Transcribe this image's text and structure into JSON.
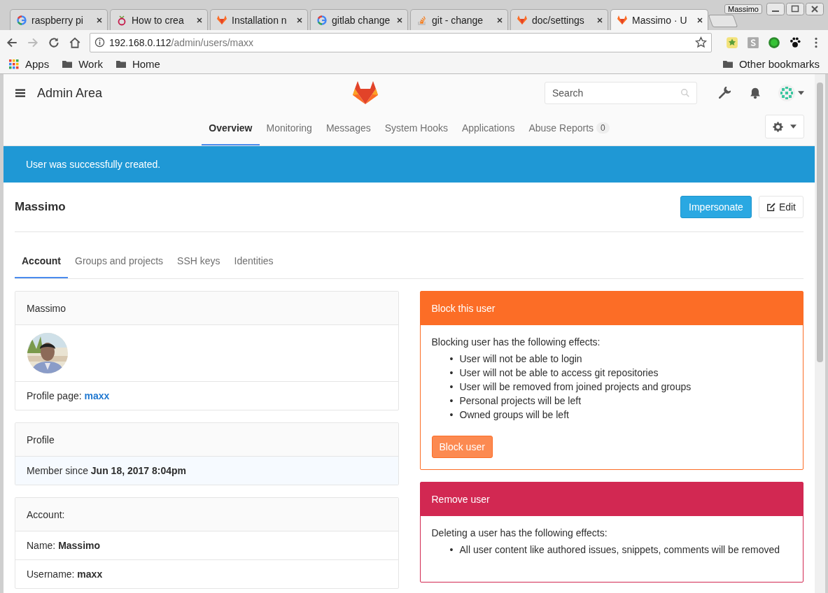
{
  "browser": {
    "profile": "Massimo",
    "tabs": [
      {
        "title": "raspberry pi",
        "kind": "google",
        "selected": false
      },
      {
        "title": "How to crea",
        "kind": "berry",
        "selected": false
      },
      {
        "title": "Installation n",
        "kind": "fox",
        "selected": false
      },
      {
        "title": "gitlab change",
        "kind": "google",
        "selected": false
      },
      {
        "title": "git - change",
        "kind": "stack",
        "selected": false
      },
      {
        "title": "doc/settings",
        "kind": "fox",
        "selected": false
      },
      {
        "title": "Massimo · U",
        "kind": "fox",
        "selected": true
      }
    ],
    "url": {
      "host": "192.168.0.112",
      "path": "/admin/users/maxx"
    },
    "bookmarks": [
      {
        "label": "Apps",
        "kind": "apps"
      },
      {
        "label": "Work",
        "kind": "folder"
      },
      {
        "label": "Home",
        "kind": "folder"
      }
    ],
    "other_bookmarks": "Other bookmarks"
  },
  "header": {
    "title": "Admin Area",
    "search": {
      "placeholder": "Search"
    }
  },
  "nav": [
    {
      "label": "Overview",
      "selected": true
    },
    {
      "label": "Monitoring",
      "selected": false
    },
    {
      "label": "Messages",
      "selected": false
    },
    {
      "label": "System Hooks",
      "selected": false
    },
    {
      "label": "Applications",
      "selected": false
    },
    {
      "label": "Abuse Reports",
      "selected": false,
      "count": "0"
    }
  ],
  "flash": "User was successfully created.",
  "user": {
    "name": "Massimo",
    "impersonate": "Impersonate",
    "edit": "Edit"
  },
  "tabs": [
    {
      "label": "Account",
      "selected": true
    },
    {
      "label": "Groups and projects",
      "selected": false
    },
    {
      "label": "SSH keys",
      "selected": false
    },
    {
      "label": "Identities",
      "selected": false
    }
  ],
  "left_panels": [
    {
      "title": "Massimo",
      "rows": [
        {
          "kind": "avatar"
        },
        {
          "kind": "link",
          "text": "Profile page:",
          "link": "maxx"
        }
      ]
    },
    {
      "title": "Profile",
      "rows": [
        {
          "kind": "timestamp",
          "text": "Member since **Jun 18, 2017 8:04pm**"
        }
      ]
    },
    {
      "title": "Account:",
      "rows": [
        {
          "kind": "text",
          "text": "Name: **Massimo**"
        },
        {
          "kind": "text",
          "text": "Username: **maxx**"
        }
      ]
    }
  ],
  "right_panels": [
    {
      "title": "Block this user",
      "kind": "warning",
      "intro": "Blocking user has the following effects:",
      "marker": "•",
      "items": [
        "User will not be able to login",
        "User will not be able to access git repositories",
        "User will be removed from joined projects and groups",
        "Personal projects will be left",
        "Owned groups will be left"
      ],
      "button": "Block user"
    },
    {
      "title": "Remove user",
      "kind": "danger",
      "intro": "Deleting a user has the following effects:",
      "marker": "•",
      "items": [
        "All user content like authored issues, snippets, comments will be removed"
      ]
    }
  ]
}
